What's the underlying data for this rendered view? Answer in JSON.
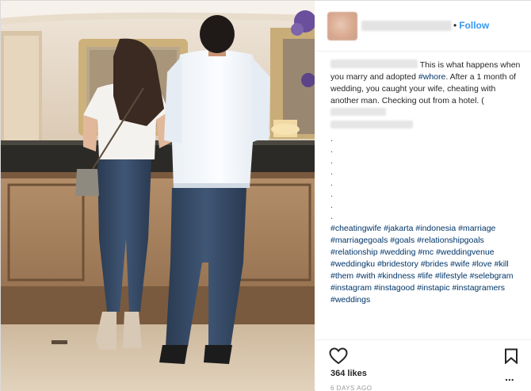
{
  "header": {
    "follow_separator": "•",
    "follow_label": "Follow"
  },
  "caption": {
    "text_1": "This is what happens when you marry and adopted ",
    "hashtag_1": "#whore",
    "text_2": ". After a 1 month of wedding, you caught your wife, cheating with another man. Checking out from a hotel. (",
    "dot_lines": [
      ".",
      ".",
      ".",
      ".",
      ".",
      ".",
      ".",
      "."
    ],
    "hashtags": "#cheatingwife #jakarta #indonesia #marriage #marriagegoals #goals #relationshipgoals #relationship #wedding #mc #weddingvenue #weddingku #bridestory #brides #wife #love #kill #them #with #kindness #life #lifestyle #selebgram #instagram #instagood #instapic #instagramers #weddings"
  },
  "footer": {
    "likes": "364 likes",
    "time_ago": "6 DAYS AGO",
    "more_label": "..."
  },
  "icons": {
    "like": "heart-outline-icon",
    "save": "bookmark-icon",
    "options": "more-options-icon"
  },
  "colors": {
    "link": "#3897f0",
    "hashtag": "#003569",
    "text": "#262626",
    "muted": "#999999"
  }
}
